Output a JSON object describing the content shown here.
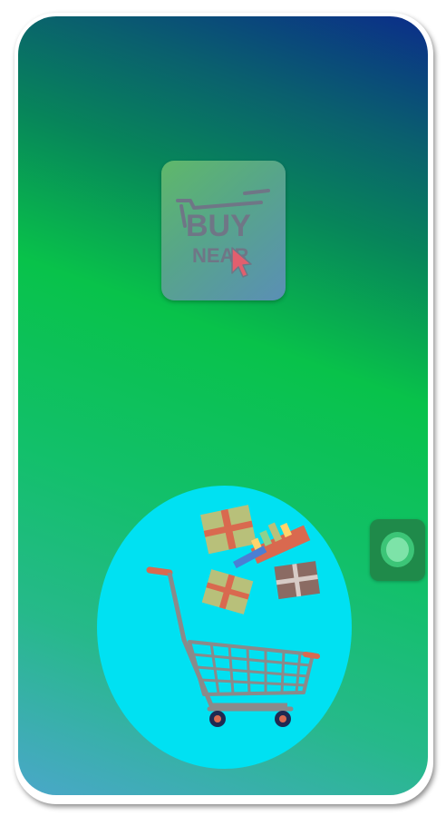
{
  "app": {
    "logo": {
      "line1": "BUY",
      "line2": "NEAR"
    },
    "colors": {
      "screen_top": "#0b2d8a",
      "screen_mid": "#08c24a",
      "screen_bottom": "#4aa7c9",
      "hero_circle": "#00e1f2",
      "toggle_bg": "#1f8a4a",
      "toggle_knob": "#7de3a8"
    },
    "icons": {
      "logo": "cart-logo-icon",
      "hero": "shopping-cart-with-gifts-illustration",
      "side_button": "circle-toggle-icon"
    }
  }
}
